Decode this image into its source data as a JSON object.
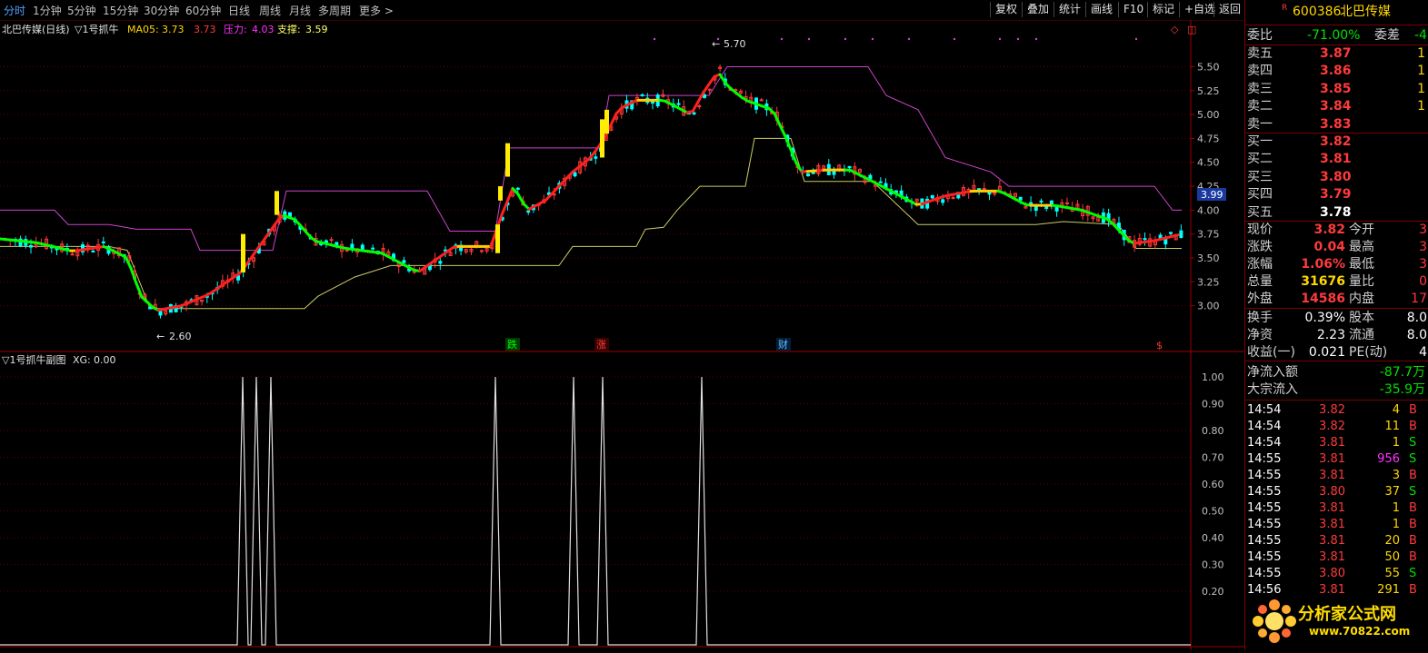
{
  "toolbar": {
    "timeframes": [
      "分时",
      "1分钟",
      "5分钟",
      "15分钟",
      "30分钟",
      "60分钟",
      "日线",
      "周线",
      "月线",
      "多周期",
      "更多 >"
    ],
    "buttons": [
      "复权",
      "叠加",
      "统计",
      "画线",
      "F10",
      "标记",
      "+自选",
      "返回"
    ]
  },
  "main_header": {
    "title": "北巴传媒(日线)",
    "indicator": "▽1号抓牛",
    "ma_label": "MA05:",
    "ma_value": "3.73",
    "ma_value2": "3.73",
    "pressure_label": "压力:",
    "pressure_value": "4.03",
    "support_label": "支撑:",
    "support_value": "3.59"
  },
  "sub_header": {
    "title": "▽1号抓牛副图",
    "xg_label": "XG:",
    "xg_value": "0.00"
  },
  "chart_data": [
    {
      "type": "line",
      "name": "main",
      "y_ticks": [
        "5.50",
        "5.25",
        "5.00",
        "4.75",
        "4.50",
        "4.25",
        "4.00",
        "3.75",
        "3.50",
        "3.25",
        "3.00"
      ],
      "ylim": [
        2.55,
        5.78
      ],
      "current_price_label": "3.99",
      "high_marker": "5.70",
      "low_marker": "2.60",
      "event_markers": [
        "跌",
        "涨",
        "财",
        "$"
      ],
      "colors": {
        "up": "#ff3a3a",
        "down": "#00ffff",
        "ma_up": "#ff2020",
        "ma_down": "#00ff00",
        "ma_flat": "#ffcc00",
        "resistance": "#cc44cc",
        "support": "#cccc66"
      }
    },
    {
      "type": "line",
      "name": "sub",
      "y_ticks": [
        "1.00",
        "0.90",
        "0.80",
        "0.70",
        "0.60",
        "0.50",
        "0.40",
        "0.30",
        "0.20"
      ],
      "ylim": [
        0,
        1
      ],
      "spike_x": [
        267,
        282,
        298,
        545,
        631,
        663,
        772
      ],
      "colors": {
        "line": "#e0e0e0"
      }
    }
  ],
  "quote": {
    "code_prefix": "R",
    "code": "600386",
    "name": "北巴传媒",
    "weibi_label": "委比",
    "weibi_value": "-71.00%",
    "weicha_label": "委差",
    "weicha_value": "-4",
    "asks": [
      {
        "label": "卖五",
        "price": "3.87",
        "vol": "1"
      },
      {
        "label": "卖四",
        "price": "3.86",
        "vol": "1"
      },
      {
        "label": "卖三",
        "price": "3.85",
        "vol": "1"
      },
      {
        "label": "卖二",
        "price": "3.84",
        "vol": "1"
      },
      {
        "label": "卖一",
        "price": "3.83",
        "vol": ""
      }
    ],
    "bids": [
      {
        "label": "买一",
        "price": "3.82",
        "vol": ""
      },
      {
        "label": "买二",
        "price": "3.81",
        "vol": ""
      },
      {
        "label": "买三",
        "price": "3.80",
        "vol": ""
      },
      {
        "label": "买四",
        "price": "3.79",
        "vol": ""
      },
      {
        "label": "买五",
        "price": "3.78",
        "vol": ""
      }
    ],
    "stats": [
      {
        "l1": "现价",
        "v1": "3.82",
        "c1": "red",
        "l2": "今开",
        "v2": "3"
      },
      {
        "l1": "涨跌",
        "v1": "0.04",
        "c1": "red",
        "l2": "最高",
        "v2": "3"
      },
      {
        "l1": "涨幅",
        "v1": "1.06%",
        "c1": "red",
        "l2": "最低",
        "v2": "3"
      },
      {
        "l1": "总量",
        "v1": "31676",
        "c1": "yellow",
        "l2": "量比",
        "v2": "0"
      },
      {
        "l1": "外盘",
        "v1": "14586",
        "c1": "red",
        "l2": "内盘",
        "v2": "17"
      }
    ],
    "stats2": [
      {
        "l1": "换手",
        "v1": "0.39%",
        "l2": "股本",
        "v2": "8.0"
      },
      {
        "l1": "净资",
        "v1": "2.23",
        "l2": "流通",
        "v2": "8.0"
      },
      {
        "l1": "收益(一)",
        "v1": "0.021",
        "l2": "PE(动)",
        "v2": "4"
      }
    ],
    "flows": [
      {
        "label": "净流入额",
        "value": "-87.7万"
      },
      {
        "label": "大宗流入",
        "value": "-35.9万"
      }
    ],
    "ticks": [
      {
        "time": "14:54",
        "price": "3.82",
        "vol": "4",
        "side": "B"
      },
      {
        "time": "14:54",
        "price": "3.82",
        "vol": "11",
        "side": "B"
      },
      {
        "time": "14:54",
        "price": "3.81",
        "vol": "1",
        "side": "S"
      },
      {
        "time": "14:55",
        "price": "3.81",
        "vol": "956",
        "side": "S"
      },
      {
        "time": "14:55",
        "price": "3.81",
        "vol": "3",
        "side": "B"
      },
      {
        "time": "14:55",
        "price": "3.80",
        "vol": "37",
        "side": "S"
      },
      {
        "time": "14:55",
        "price": "3.81",
        "vol": "1",
        "side": "B"
      },
      {
        "time": "14:55",
        "price": "3.81",
        "vol": "1",
        "side": "B"
      },
      {
        "time": "14:55",
        "price": "3.81",
        "vol": "20",
        "side": "B"
      },
      {
        "time": "14:55",
        "price": "3.81",
        "vol": "50",
        "side": "B"
      },
      {
        "time": "14:55",
        "price": "3.80",
        "vol": "55",
        "side": "S"
      },
      {
        "time": "14:56",
        "price": "3.81",
        "vol": "291",
        "side": "B"
      }
    ],
    "watermark": "分析家公式网",
    "watermark_url": "www.70822.com"
  }
}
